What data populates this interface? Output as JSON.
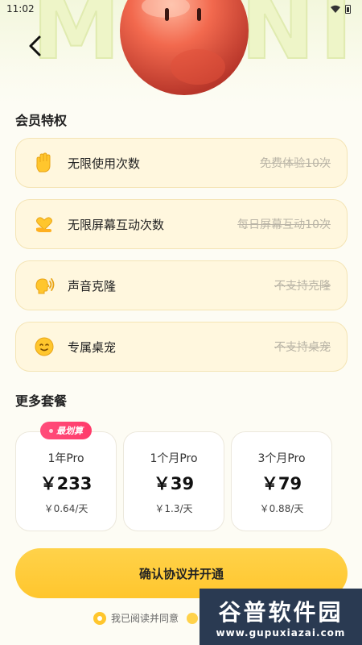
{
  "status_bar": {
    "time": "11:02"
  },
  "hero": {
    "background_word": "MO NI"
  },
  "perks": {
    "title": "会员特权",
    "items": [
      {
        "label": "无限使用次数",
        "free": "免费体验10次",
        "icon": "wave-hand-icon"
      },
      {
        "label": "无限屏幕互动次数",
        "free": "每日屏幕互动10次",
        "icon": "heart-hand-icon"
      },
      {
        "label": "声音克隆",
        "free": "不支持克隆",
        "icon": "voice-clone-icon"
      },
      {
        "label": "专属桌宠",
        "free": "不支持桌宠",
        "icon": "desktop-pet-icon"
      }
    ]
  },
  "plans": {
    "title": "更多套餐",
    "badge": "最划算",
    "items": [
      {
        "name": "1年Pro",
        "price": "￥233",
        "unit": "￥0.64/天"
      },
      {
        "name": "1个月Pro",
        "price": "￥39",
        "unit": "￥1.3/天"
      },
      {
        "name": "3个月Pro",
        "price": "￥79",
        "unit": "￥0.88/天"
      }
    ]
  },
  "confirm": {
    "label": "确认协议并开通"
  },
  "agreement": {
    "text": "我已阅读并同意"
  },
  "watermark": {
    "title": "谷普软件园",
    "url": "www.gupuxiazai.com"
  },
  "colors": {
    "accent": "#ffc62d",
    "badge": "#ff3b6b",
    "card_bg": "#fff7de"
  }
}
